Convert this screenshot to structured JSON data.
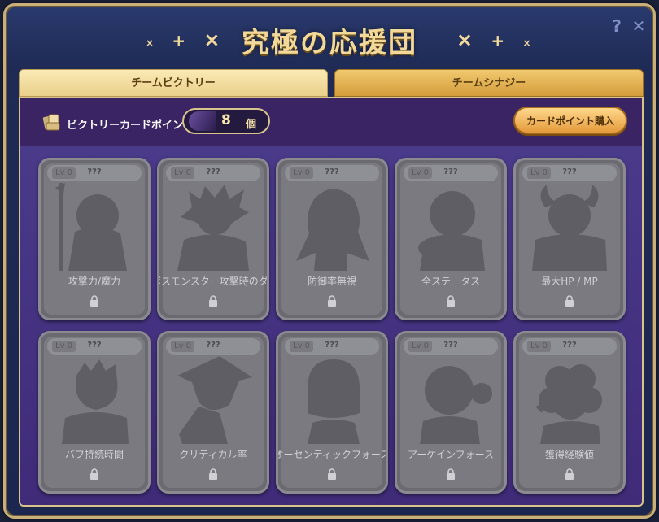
{
  "title": {
    "text": "究極の応援団",
    "deco_left": [
      "×",
      "+",
      "×"
    ],
    "deco_right": [
      "×",
      "+",
      "×"
    ]
  },
  "window_controls": {
    "help": "?",
    "close": "✕"
  },
  "tabs": [
    {
      "label": "チームビクトリー",
      "active": true
    },
    {
      "label": "チームシナジー",
      "active": false
    }
  ],
  "points": {
    "label": "ビクトリーカードポイント",
    "value": "8",
    "unit": "個"
  },
  "buy_button": {
    "label": "カードポイント購入"
  },
  "cards": [
    {
      "level": "Lv 0",
      "name": "???",
      "label": "攻撃力/魔力",
      "icon": "staff-girl-silhouette"
    },
    {
      "level": "Lv 0",
      "name": "???",
      "label": "ボスモンスター攻撃時のダメージ",
      "icon": "spiky-hair-silhouette"
    },
    {
      "level": "Lv 0",
      "name": "???",
      "label": "防御率無視",
      "icon": "long-hair-silhouette"
    },
    {
      "level": "Lv 0",
      "name": "???",
      "label": "全ステータス",
      "icon": "short-hair-silhouette"
    },
    {
      "level": "Lv 0",
      "name": "???",
      "label": "最大HP / MP",
      "icon": "horned-silhouette"
    },
    {
      "level": "Lv 0",
      "name": "???",
      "label": "バフ持続時間",
      "icon": "boy-silhouette"
    },
    {
      "level": "Lv 0",
      "name": "???",
      "label": "クリティカル率",
      "icon": "hat-silhouette"
    },
    {
      "level": "Lv 0",
      "name": "???",
      "label": "オーセンティックフォース",
      "icon": "bob-hair-silhouette"
    },
    {
      "level": "Lv 0",
      "name": "???",
      "label": "アーケインフォース",
      "icon": "bun-hair-silhouette"
    },
    {
      "level": "Lv 0",
      "name": "???",
      "label": "獲得経験値",
      "icon": "curly-hair-silhouette"
    }
  ],
  "colors": {
    "title_gold": "#f2d99a",
    "window_bg": "#1f2b55",
    "content_bg": "#3d2b6b",
    "card_locked": "#7a7a80",
    "buy_button": "#e49a3b"
  }
}
